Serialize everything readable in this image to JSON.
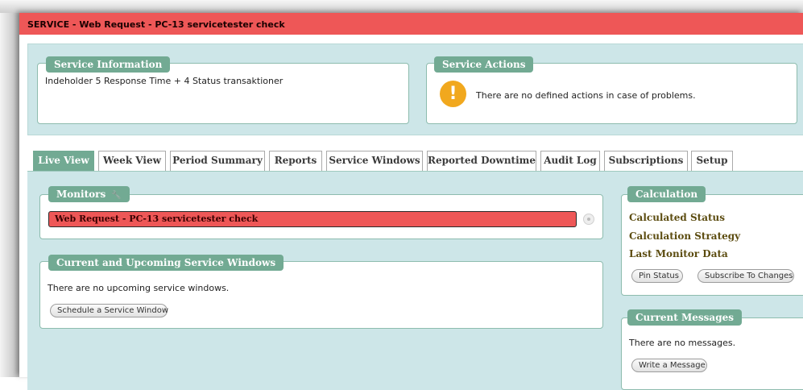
{
  "window": {
    "title": "SERVICE - Web Request - PC-13 servicetester check"
  },
  "service_information": {
    "legend": "Service Information",
    "text": "Indeholder 5 Response Time + 4 Status transaktioner"
  },
  "service_actions": {
    "legend": "Service Actions",
    "warning_glyph": "!",
    "text": "There are no defined actions in case of problems."
  },
  "tabs": [
    {
      "label": "Live View",
      "active": true
    },
    {
      "label": "Week View"
    },
    {
      "label": "Period Summary"
    },
    {
      "label": "Reports"
    },
    {
      "label": "Service Windows"
    },
    {
      "label": "Reported Downtime"
    },
    {
      "label": "Audit Log"
    },
    {
      "label": "Subscriptions"
    },
    {
      "label": "Setup"
    }
  ],
  "monitors": {
    "legend": "Monitors",
    "wrench_glyph": "🔧",
    "items": [
      {
        "label": "Web Request - PC-13 servicetester check",
        "status_color": "#ee5757"
      }
    ]
  },
  "service_windows": {
    "legend": "Current and Upcoming Service Windows",
    "empty_text": "There are no upcoming service windows.",
    "schedule_button": "Schedule a Service Window"
  },
  "calculation": {
    "legend": "Calculation",
    "rows": [
      "Calculated Status",
      "Calculation Strategy",
      "Last Monitor Data"
    ],
    "pin_button": "Pin Status",
    "subscribe_button": "Subscribe To Changes"
  },
  "messages": {
    "legend": "Current Messages",
    "empty_text": "There are no messages.",
    "write_button": "Write a Message"
  },
  "colors": {
    "title_bar": "#ee5757",
    "legend": "#72aa93",
    "background": "#cde6e8",
    "warning": "#f1a81e"
  }
}
